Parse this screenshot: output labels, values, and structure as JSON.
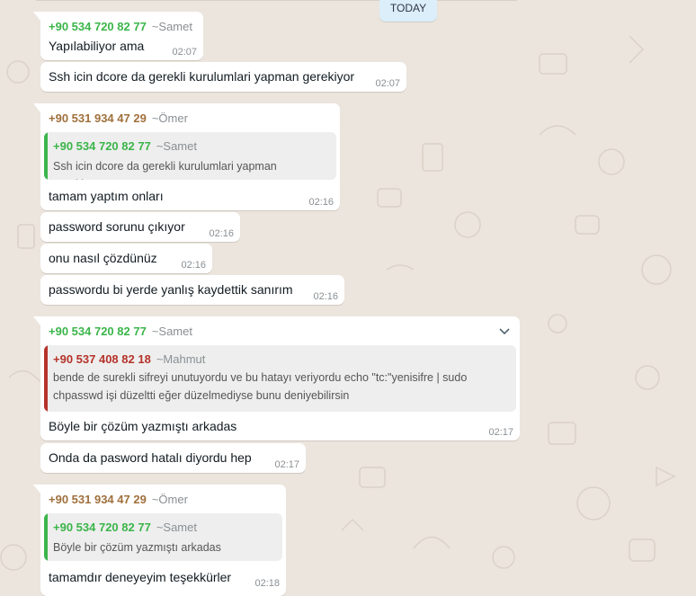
{
  "date_chip": "TODAY",
  "messages": [
    {
      "sender": "+90 534 720 82 77",
      "alias": "~Samet",
      "text": "Yapılabiliyor ama",
      "time": "02:07"
    },
    {
      "text": "Ssh icin dcore da gerekli kurulumlari yapman gerekiyor",
      "time": "02:07"
    },
    {
      "sender": "+90 531 934 47 29",
      "alias": "~Ömer",
      "quote": {
        "sender": "+90 534 720 82 77",
        "alias": "~Samet",
        "text": "Ssh icin dcore da gerekli kurulumlari yapman gerekiyor"
      },
      "text": "tamam yaptım onları",
      "time": "02:16"
    },
    {
      "text": "password sorunu çıkıyor",
      "time": "02:16"
    },
    {
      "text": "onu nasıl çözdünüz",
      "time": "02:16"
    },
    {
      "text": "passwordu bi yerde yanlış kaydettik sanırım",
      "time": "02:16"
    },
    {
      "sender": "+90 534 720 82 77",
      "alias": "~Samet",
      "quote": {
        "sender": "+90 537 408 82 18",
        "alias": "~Mahmut",
        "text": "bende de surekli sifreyi unutuyordu ve bu hatayı veriyordu   echo \"tc:\"yenisifre | sudo chpasswd işi düzeltti eğer düzelmediyse bunu deniyebilirsin"
      },
      "text": "Böyle bir çözüm yazmıştı arkadas",
      "time": "02:17"
    },
    {
      "text": "Onda da pasword hatalı diyordu hep",
      "time": "02:17"
    },
    {
      "sender": "+90 531 934 47 29",
      "alias": "~Ömer",
      "quote": {
        "sender": "+90 534 720 82 77",
        "alias": "~Samet",
        "text": "Böyle bir çözüm yazmıştı arkadas"
      },
      "text": "tamamdır deneyeyim teşekkürler",
      "time": "02:18"
    }
  ]
}
